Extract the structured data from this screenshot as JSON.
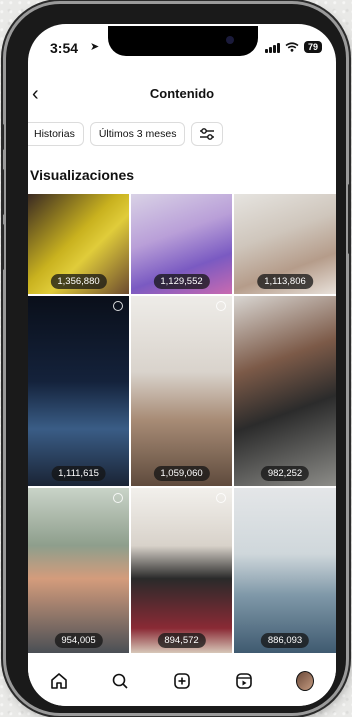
{
  "status_bar": {
    "time": "3:54",
    "battery": "79"
  },
  "header": {
    "back_icon": "back-arrow-icon",
    "title": "Contenido"
  },
  "filters": {
    "chip1": "Historias",
    "chip2": "Últimos 3 meses",
    "settings_icon": "sliders-icon"
  },
  "section_title": "Visualizaciones",
  "tiles": [
    {
      "views": "1,356,880",
      "bg": "linear-gradient(135deg,#3a2a22 0%,#c9b21f 45%,#e0cc3a 60%,#6b4a2f 100%)",
      "reel": false
    },
    {
      "views": "1,129,552",
      "bg": "linear-gradient(160deg,#d9d2e6 0%,#b99fd8 40%,#7a5ac2 70%,#c96ab0 100%)",
      "reel": false
    },
    {
      "views": "1,113,806",
      "bg": "linear-gradient(160deg,#e6e4e0 0%,#cfc6bc 40%,#b59c8a 70%,#e8e1da 100%)",
      "reel": false
    },
    {
      "views": "1,111,615",
      "bg": "linear-gradient(180deg,#0a0f1a 0%,#14223b 45%,#3a5d86 70%,#1a2435 100%)",
      "reel": true
    },
    {
      "views": "1,059,060",
      "bg": "linear-gradient(180deg,#eeece8 0%,#d9d3cc 40%,#a88c76 65%,#5f4b3d 100%)",
      "reel": true
    },
    {
      "views": "982,252",
      "bg": "linear-gradient(160deg,#d9d6d2 0%,#7c5a48 35%,#2b2b2b 60%,#8c8c88 100%)",
      "reel": false
    },
    {
      "views": "954,005",
      "bg": "linear-gradient(180deg,#c9d3c8 0%,#8e9e8c 35%,#d49c7c 55%,#4a4f55 100%)",
      "reel": true
    },
    {
      "views": "894,572",
      "bg": "linear-gradient(180deg,#f2f0ec 0%,#d8d2ca 35%,#2a2a2a 55%,#8a2a35 85%,#d7c7b8 100%)",
      "reel": true
    },
    {
      "views": "886,093",
      "bg": "linear-gradient(180deg,#e4e6e8 0%,#cfd7db 40%,#7f98a8 65%,#3f5a70 100%)",
      "reel": false
    }
  ],
  "tabbar": [
    "home-icon",
    "search-icon",
    "create-icon",
    "reels-icon",
    "profile-avatar"
  ]
}
